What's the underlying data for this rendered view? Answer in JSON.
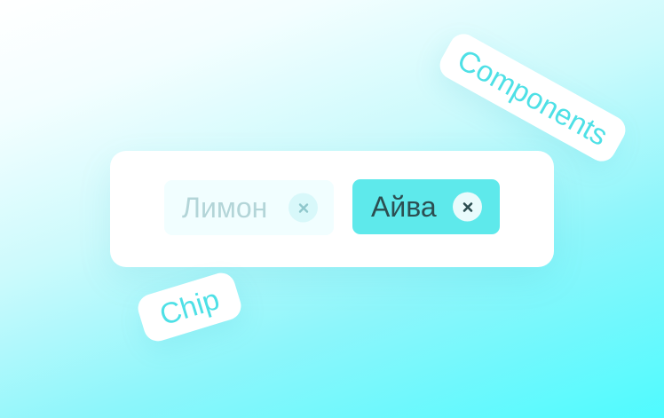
{
  "tags": {
    "components_label": "Components",
    "chip_label": "Chip"
  },
  "chips": [
    {
      "label": "Лимон",
      "state": "disabled",
      "close_icon": "close-icon"
    },
    {
      "label": "Айва",
      "state": "active",
      "close_icon": "close-icon"
    }
  ],
  "colors": {
    "accent": "#4ee0e6",
    "chip_active_bg": "#5ee9eb",
    "chip_active_text": "#2c4e51",
    "chip_disabled_bg": "#f1feff",
    "chip_disabled_text": "#b3d5d8",
    "card_bg": "#ffffff",
    "background_start": "#ffffff",
    "background_end": "#4ffbff"
  }
}
